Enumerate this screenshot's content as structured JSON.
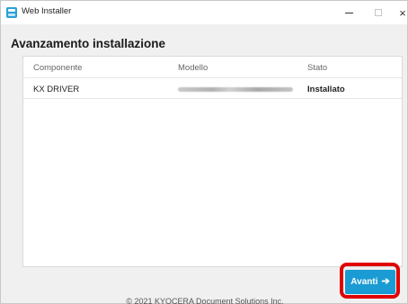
{
  "window": {
    "title": "Web Installer",
    "minimize_icon": "minimize-icon",
    "maximize_icon": "maximize-icon",
    "close_glyph": "×"
  },
  "page": {
    "title": "Avanzamento installazione"
  },
  "table": {
    "columns": [
      "Componente",
      "Modello",
      "Stato"
    ],
    "rows": [
      {
        "component": "KX DRIVER",
        "model": "",
        "status": "Installato"
      }
    ]
  },
  "actions": {
    "next_label": "Avanti",
    "next_icon": "arrow-right-icon",
    "next_arrow": "➔",
    "highlight_color": "#e00000",
    "button_color": "#1a9bd3"
  },
  "footer": {
    "copyright": "© 2021 KYOCERA Document Solutions Inc."
  }
}
